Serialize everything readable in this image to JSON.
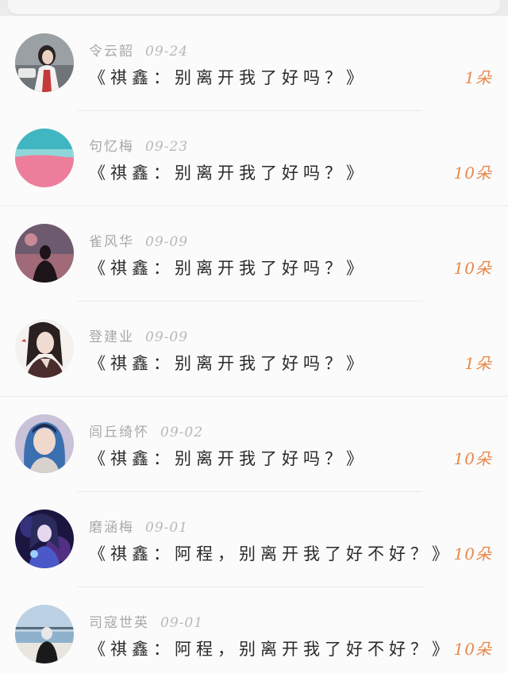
{
  "messages": [
    {
      "name": "令云韶",
      "date": "09-24",
      "text": "《祺鑫：别离开我了好吗？》",
      "count": "1朵"
    },
    {
      "name": "句忆梅",
      "date": "09-23",
      "text": "《祺鑫：别离开我了好吗？》",
      "count": "10朵"
    },
    {
      "name": "雀风华",
      "date": "09-09",
      "text": "《祺鑫：别离开我了好吗？》",
      "count": "10朵"
    },
    {
      "name": "登建业",
      "date": "09-09",
      "text": "《祺鑫：别离开我了好吗？》",
      "count": "1朵"
    },
    {
      "name": "闾丘绮怀",
      "date": "09-02",
      "text": "《祺鑫：别离开我了好吗？》",
      "count": "10朵"
    },
    {
      "name": "磨涵梅",
      "date": "09-01",
      "text": "《祺鑫：阿程，别离开我了好不好？》",
      "count": "10朵"
    },
    {
      "name": "司寇世英",
      "date": "09-01",
      "text": "《祺鑫：阿程，别离开我了好不好？》",
      "count": "10朵"
    }
  ],
  "theme": {
    "accent": "#e8884a",
    "name_color": "#a8a8a8",
    "text_color": "#2a2a2a"
  }
}
